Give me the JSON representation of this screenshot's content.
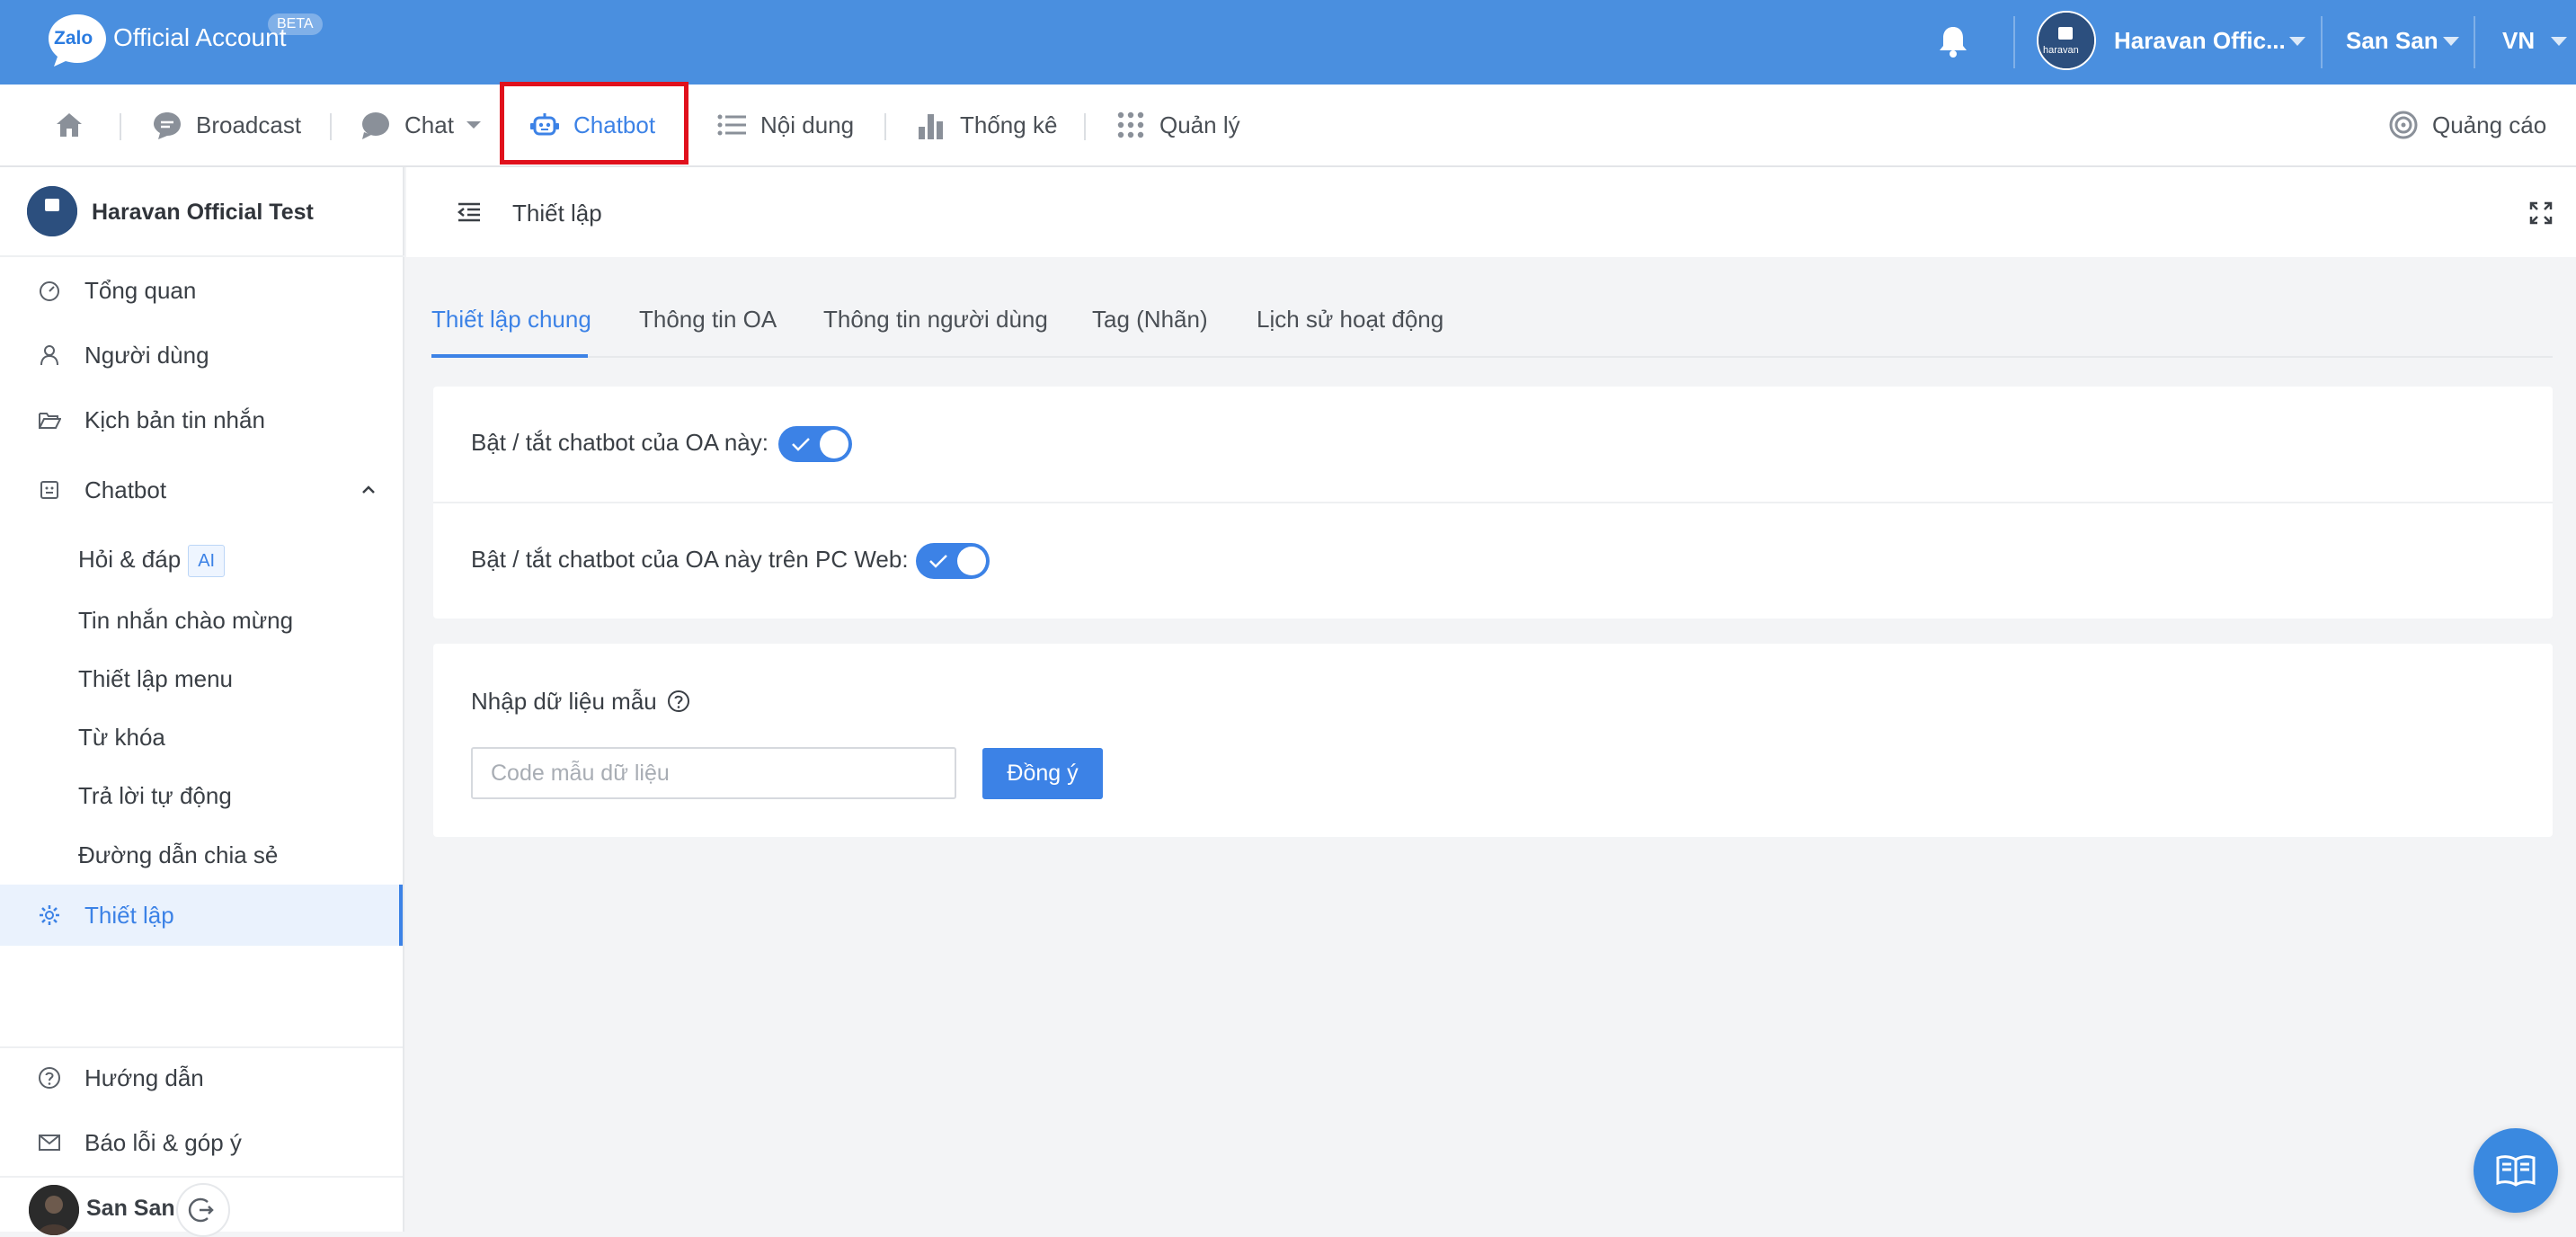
{
  "brand": {
    "logo_text": "Zalo",
    "name": "Official Account",
    "badge": "BETA"
  },
  "topbar": {
    "account_name": "Haravan Offic...",
    "user_name": "San San",
    "language": "VN",
    "avatar_text": "haravan"
  },
  "nav": {
    "items": [
      {
        "label": "Broadcast",
        "icon": "broadcast-icon"
      },
      {
        "label": "Chat",
        "icon": "chat-icon"
      },
      {
        "label": "Chatbot",
        "icon": "robot-icon"
      },
      {
        "label": "Nội dung",
        "icon": "list-icon"
      },
      {
        "label": "Thống kê",
        "icon": "bar-chart-icon"
      },
      {
        "label": "Quản lý",
        "icon": "grid-icon"
      }
    ],
    "ads_label": "Quảng cáo"
  },
  "sidebar": {
    "oa_name": "Haravan Official Test",
    "items": [
      {
        "label": "Tổng quan"
      },
      {
        "label": "Người dùng"
      },
      {
        "label": "Kịch bản tin nhắn"
      },
      {
        "label": "Chatbot"
      }
    ],
    "chatbot_sub": [
      {
        "label": "Hỏi & đáp",
        "badge": "AI"
      },
      {
        "label": "Tin nhắn chào mừng"
      },
      {
        "label": "Thiết lập menu"
      },
      {
        "label": "Từ khóa"
      },
      {
        "label": "Trả lời tự động"
      },
      {
        "label": "Đường dẫn chia sẻ"
      }
    ],
    "active_item": "Thiết lập",
    "footer": [
      {
        "label": "Hướng dẫn"
      },
      {
        "label": "Báo lỗi & góp ý"
      }
    ],
    "user_name": "San San"
  },
  "content": {
    "title": "Thiết lập",
    "tabs": [
      {
        "label": "Thiết lập chung",
        "active": true
      },
      {
        "label": "Thông tin OA"
      },
      {
        "label": "Thông tin người dùng"
      },
      {
        "label": "Tag (Nhãn)"
      },
      {
        "label": "Lịch sử hoạt động"
      }
    ],
    "toggle_rows": [
      {
        "label": "Bật / tắt chatbot của OA này:",
        "enabled": true
      },
      {
        "label": "Bật / tắt chatbot của OA này trên PC Web:",
        "enabled": true
      }
    ],
    "import": {
      "label": "Nhập dữ liệu mẫu",
      "placeholder": "Code mẫu dữ liệu",
      "value": "",
      "button": "Đồng ý"
    }
  },
  "colors": {
    "primary": "#3c82e6",
    "topbar": "#4a8fdf",
    "highlight": "#e0101c"
  }
}
